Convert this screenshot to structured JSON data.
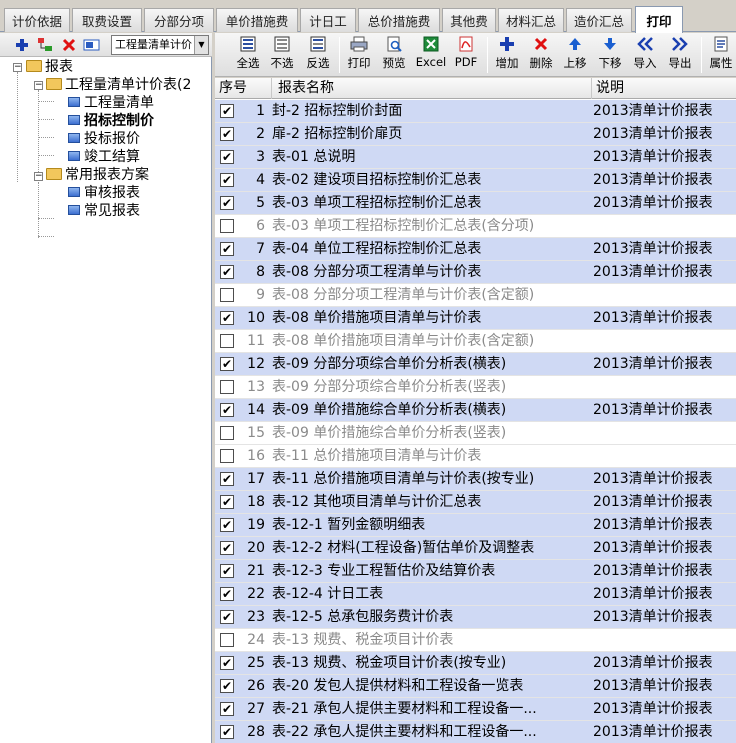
{
  "tabs": [
    "计价依据",
    "取费设置",
    "分部分项",
    "单价措施费",
    "计日工",
    "总价措施费",
    "其他费",
    "材料汇总",
    "造价汇总",
    "打印"
  ],
  "left_toolbar": {
    "combo_value": "工程量清单计价"
  },
  "tree": {
    "root": "报表",
    "group1": "工程量清单计价表(2",
    "group1_items": [
      "工程量清单",
      "招标控制价",
      "投标报价",
      "竣工结算"
    ],
    "group2": "常用报表方案",
    "group2_items": [
      "审核报表",
      "常见报表"
    ]
  },
  "toolbar": {
    "select_all": "全选",
    "select_none": "不选",
    "invert": "反选",
    "print": "打印",
    "preview": "预览",
    "excel": "Excel",
    "pdf": "PDF",
    "add": "增加",
    "delete": "删除",
    "up": "上移",
    "down": "下移",
    "import": "导入",
    "export": "导出",
    "props": "属性"
  },
  "grid": {
    "headers": [
      "序号",
      "报表名称",
      "说明"
    ],
    "rows": [
      {
        "num": "1",
        "name": "封-2 招标控制价封面",
        "note": "2013清单计价报表",
        "checked": true
      },
      {
        "num": "2",
        "name": "扉-2 招标控制价扉页",
        "note": "2013清单计价报表",
        "checked": true
      },
      {
        "num": "3",
        "name": "表-01 总说明",
        "note": "2013清单计价报表",
        "checked": true
      },
      {
        "num": "4",
        "name": "表-02 建设项目招标控制价汇总表",
        "note": "2013清单计价报表",
        "checked": true
      },
      {
        "num": "5",
        "name": "表-03 单项工程招标控制价汇总表",
        "note": "2013清单计价报表",
        "checked": true
      },
      {
        "num": "6",
        "name": "表-03 单项工程招标控制价汇总表(含分项)",
        "note": "",
        "checked": false
      },
      {
        "num": "7",
        "name": "表-04 单位工程招标控制价汇总表",
        "note": "2013清单计价报表",
        "checked": true
      },
      {
        "num": "8",
        "name": "表-08 分部分项工程清单与计价表",
        "note": "2013清单计价报表",
        "checked": true
      },
      {
        "num": "9",
        "name": "表-08 分部分项工程清单与计价表(含定额)",
        "note": "",
        "checked": false
      },
      {
        "num": "10",
        "name": "表-08 单价措施项目清单与计价表",
        "note": "2013清单计价报表",
        "checked": true
      },
      {
        "num": "11",
        "name": "表-08 单价措施项目清单与计价表(含定额)",
        "note": "",
        "checked": false
      },
      {
        "num": "12",
        "name": "表-09 分部分项综合单价分析表(横表)",
        "note": "2013清单计价报表",
        "checked": true
      },
      {
        "num": "13",
        "name": "表-09 分部分项综合单价分析表(竖表)",
        "note": "",
        "checked": false
      },
      {
        "num": "14",
        "name": "表-09 单价措施综合单价分析表(横表)",
        "note": "2013清单计价报表",
        "checked": true
      },
      {
        "num": "15",
        "name": "表-09 单价措施综合单价分析表(竖表)",
        "note": "",
        "checked": false
      },
      {
        "num": "16",
        "name": "表-11 总价措施项目清单与计价表",
        "note": "",
        "checked": false
      },
      {
        "num": "17",
        "name": "表-11 总价措施项目清单与计价表(按专业)",
        "note": "2013清单计价报表",
        "checked": true
      },
      {
        "num": "18",
        "name": "表-12 其他项目清单与计价汇总表",
        "note": "2013清单计价报表",
        "checked": true
      },
      {
        "num": "19",
        "name": "表-12-1 暂列金额明细表",
        "note": "2013清单计价报表",
        "checked": true
      },
      {
        "num": "20",
        "name": "表-12-2 材料(工程设备)暂估单价及调整表",
        "note": "2013清单计价报表",
        "checked": true
      },
      {
        "num": "21",
        "name": "表-12-3 专业工程暂估价及结算价表",
        "note": "2013清单计价报表",
        "checked": true
      },
      {
        "num": "22",
        "name": "表-12-4 计日工表",
        "note": "2013清单计价报表",
        "checked": true
      },
      {
        "num": "23",
        "name": "表-12-5 总承包服务费计价表",
        "note": "2013清单计价报表",
        "checked": true
      },
      {
        "num": "24",
        "name": "表-13 规费、税金项目计价表",
        "note": "",
        "checked": false
      },
      {
        "num": "25",
        "name": "表-13 规费、税金项目计价表(按专业)",
        "note": "2013清单计价报表",
        "checked": true
      },
      {
        "num": "26",
        "name": "表-20 发包人提供材料和工程设备一览表",
        "note": "2013清单计价报表",
        "checked": true
      },
      {
        "num": "27",
        "name": "表-21 承包人提供主要材料和工程设备一...",
        "note": "2013清单计价报表",
        "checked": true
      },
      {
        "num": "28",
        "name": "表-22 承包人提供主要材料和工程设备一...",
        "note": "2013清单计价报表",
        "checked": true
      }
    ]
  }
}
